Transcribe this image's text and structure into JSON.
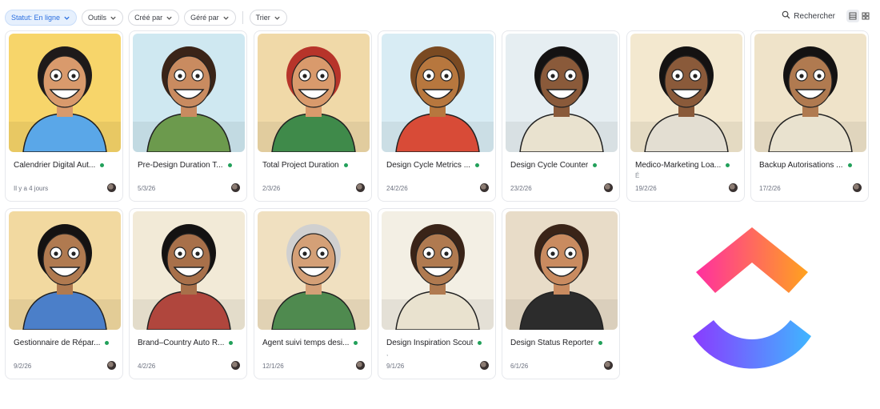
{
  "toolbar": {
    "filters": [
      {
        "label": "Statut: En ligne",
        "active": true
      },
      {
        "label": "Outils",
        "active": false
      },
      {
        "label": "Créé par",
        "active": false
      },
      {
        "label": "Géré par",
        "active": false
      },
      {
        "label": "Trier",
        "active": false
      }
    ],
    "search_label": "Rechercher"
  },
  "cards": [
    {
      "title": "Calendrier Digital Aut...",
      "sub": "",
      "date": "Il y a 4 jours",
      "bg": "#f7d56a",
      "skin": "#d99a6c",
      "hair": "#1e1a1a",
      "shirt": "#5aa7e8"
    },
    {
      "title": "Pre-Design Duration T...",
      "sub": "",
      "date": "5/3/26",
      "bg": "#cfe8f1",
      "skin": "#c98b60",
      "hair": "#3a2418",
      "shirt": "#6c9a4d"
    },
    {
      "title": "Total Project Duration",
      "sub": "",
      "date": "2/3/26",
      "bg": "#f0d9a8",
      "skin": "#d99a6c",
      "hair": "#b7342a",
      "shirt": "#3f8a4a"
    },
    {
      "title": "Design Cycle Metrics ...",
      "sub": "",
      "date": "24/2/26",
      "bg": "#d8ecf4",
      "skin": "#b7773e",
      "hair": "#7a4a22",
      "shirt": "#d84b37"
    },
    {
      "title": "Design Cycle Counter",
      "sub": "",
      "date": "23/2/26",
      "bg": "#e6eef2",
      "skin": "#8a5a3a",
      "hair": "#141212",
      "shirt": "#e9e2cf"
    },
    {
      "title": "Medico-Marketing Loa...",
      "sub": "É",
      "date": "19/2/26",
      "bg": "#f3e8cf",
      "skin": "#8a5a3a",
      "hair": "#141212",
      "shirt": "#e3ded2"
    },
    {
      "title": "Backup Autorisations ...",
      "sub": "",
      "date": "17/2/26",
      "bg": "#efe3c9",
      "skin": "#b07a50",
      "hair": "#141212",
      "shirt": "#e9e2cf"
    },
    {
      "title": "Gestionnaire de Répar...",
      "sub": "",
      "date": "9/2/26",
      "bg": "#f2d9a0",
      "skin": "#b07a50",
      "hair": "#141212",
      "shirt": "#4b7fc9"
    },
    {
      "title": "Brand–Country Auto R...",
      "sub": "",
      "date": "4/2/26",
      "bg": "#f2ead7",
      "skin": "#a8704a",
      "hair": "#141212",
      "shirt": "#b0463d"
    },
    {
      "title": "Agent suivi temps desi...",
      "sub": "",
      "date": "12/1/26",
      "bg": "#f0e0c0",
      "skin": "#d4a077",
      "hair": "#d0d0d0",
      "shirt": "#4f8a4f"
    },
    {
      "title": "Design Inspiration Scout",
      "sub": ",",
      "date": "9/1/26",
      "bg": "#f3efe4",
      "skin": "#b07a50",
      "hair": "#3a2418",
      "shirt": "#e9e2cf"
    },
    {
      "title": "Design Status Reporter",
      "sub": "",
      "date": "6/1/26",
      "bg": "#e8dcc8",
      "skin": "#c98b60",
      "hair": "#3a2418",
      "shirt": "#2c2c2c"
    }
  ],
  "colors": {
    "online": "#22a05a",
    "accent": "#2b6fe0",
    "logo_top_a": "#ff2fa0",
    "logo_top_b": "#ffa21e",
    "logo_bottom_a": "#8a3bff",
    "logo_bottom_b": "#3fb6ff"
  },
  "icons": {
    "search": "search-icon",
    "list_view": "list-view-icon",
    "grid_view": "grid-view-icon",
    "status": "online-status-icon",
    "logo": "clickup-logo"
  }
}
